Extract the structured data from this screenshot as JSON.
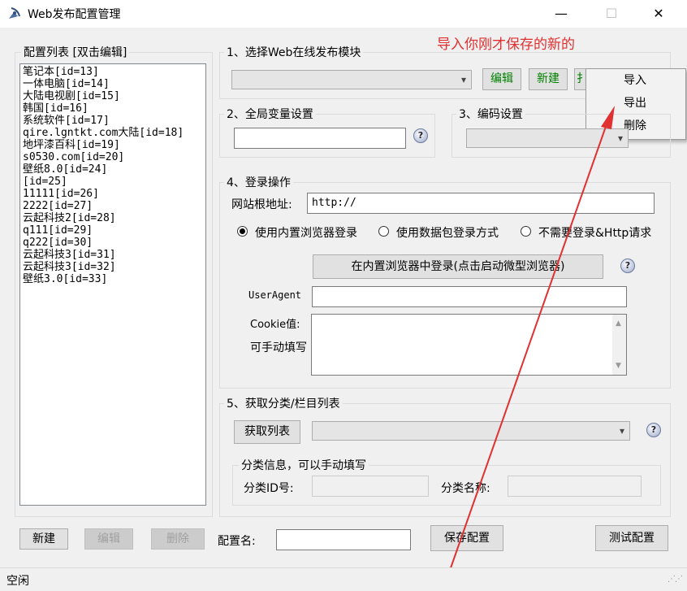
{
  "window": {
    "title": "Web发布配置管理",
    "minimize": "—",
    "maximize": "☐",
    "close": "✕"
  },
  "annotation": {
    "text": "导入你刚才保存的新的",
    "color": "#e03030"
  },
  "config_list": {
    "legend": "配置列表 [双击编辑]",
    "items": [
      "笔记本[id=13]",
      "一体电脑[id=14]",
      "大陆电视剧[id=15]",
      "韩国[id=16]",
      "系统软件[id=17]",
      "qire.lgntkt.com大陆[id=18]",
      "地坪漆百科[id=19]",
      "s0530.com[id=20]",
      "壁纸8.0[id=24]",
      "[id=25]",
      "11111[id=26]",
      "2222[id=27]",
      "云起科技2[id=28]",
      "q111[id=29]",
      "q222[id=30]",
      "云起科技3[id=31]",
      "云起科技3[id=32]",
      "壁纸3.0[id=33]"
    ]
  },
  "section1": {
    "legend": "1、选择Web在线发布模块",
    "module_select": "",
    "edit_btn": "编辑",
    "new_btn": "新建",
    "import_btn_partial": "扌"
  },
  "context_menu": {
    "items": [
      "导入",
      "导出",
      "删除"
    ]
  },
  "section2": {
    "legend": "2、全局变量设置",
    "value": ""
  },
  "section3": {
    "legend": "3、编码设置",
    "value": ""
  },
  "section4": {
    "legend": "4、登录操作",
    "site_root_label": "网站根地址:",
    "site_root_value": "http://",
    "radio_builtin": "使用内置浏览器登录",
    "radio_packet": "使用数据包登录方式",
    "radio_none": "不需要登录&Http请求",
    "browser_login_btn": "在内置浏览器中登录(点击启动微型浏览器)",
    "useragent_label": "UserAgent",
    "useragent_value": "",
    "cookie_label": "Cookie值:",
    "cookie_hint": "可手动填写",
    "cookie_value": ""
  },
  "section5": {
    "legend": "5、获取分类/栏目列表",
    "fetch_btn": "获取列表",
    "category_select": "",
    "sub_legend": "分类信息，可以手动填写",
    "cat_id_label": "分类ID号:",
    "cat_id_value": "",
    "cat_name_label": "分类名称:",
    "cat_name_value": ""
  },
  "bottom": {
    "new_btn": "新建",
    "edit_btn": "编辑",
    "delete_btn": "删除",
    "config_name_label": "配置名:",
    "config_name_value": "",
    "save_btn": "保存配置",
    "test_btn": "测试配置"
  },
  "status": {
    "text": "空闲"
  },
  "icons": {
    "help": "?",
    "app": "satellite-icon",
    "dropdown": "▾"
  }
}
